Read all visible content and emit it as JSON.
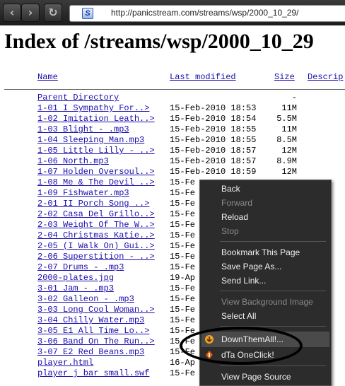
{
  "browser": {
    "url": "http://panicstream.com/streams/wsp/2000_10_29/",
    "back_icon": "back-arrow-icon",
    "forward_icon": "forward-arrow-icon",
    "reload_icon": "reload-icon",
    "favicon_letter": "S"
  },
  "page": {
    "title": "Index of /streams/wsp/2000_10_29",
    "columns": {
      "name": "Name",
      "modified": "Last modified",
      "size": "Size",
      "description": "Descrip"
    },
    "parent": {
      "name": "Parent Directory",
      "size": "-"
    },
    "rows": [
      {
        "name": "1-01 I  Sympathy For..>",
        "date": "15-Feb-2010 18:53",
        "size": "11M"
      },
      {
        "name": "1-02 Imitation Leath..>",
        "date": "15-Feb-2010 18:54",
        "size": "5.5M"
      },
      {
        "name": "1-03 Blight - .mp3",
        "date": "15-Feb-2010 18:55",
        "size": "11M"
      },
      {
        "name": "1-04 Sleeping Man.mp3",
        "date": "15-Feb-2010 18:55",
        "size": "8.5M"
      },
      {
        "name": "1-05 Little Lilly - ..>",
        "date": "15-Feb-2010 18:57",
        "size": "12M"
      },
      {
        "name": "1-06 North.mp3",
        "date": "15-Feb-2010 18:57",
        "size": "8.9M"
      },
      {
        "name": "1-07 Holden Oversoul..>",
        "date": "15-Feb-2010 18:59",
        "size": "12M"
      },
      {
        "name": "1-08 Me & The Devil ..>",
        "date": "15-Fe",
        "size": ""
      },
      {
        "name": "1-09 Fishwater.mp3",
        "date": "15-Fe",
        "size": ""
      },
      {
        "name": "2-01 II  Porch Song ..>",
        "date": "15-Fe",
        "size": ""
      },
      {
        "name": "2-02 Casa Del Grillo..>",
        "date": "15-Fe",
        "size": ""
      },
      {
        "name": "2-03 Weight Of The W..>",
        "date": "15-Fe",
        "size": ""
      },
      {
        "name": "2-04 Christmas Katie..>",
        "date": "15-Fe",
        "size": ""
      },
      {
        "name": "2-05 (I Walk On) Gui..>",
        "date": "15-Fe",
        "size": ""
      },
      {
        "name": "2-06 Superstition - ..>",
        "date": "15-Fe",
        "size": ""
      },
      {
        "name": "2-07 Drums - .mp3",
        "date": "15-Fe",
        "size": ""
      },
      {
        "name": "2000-plates.jpg",
        "date": "19-Ap",
        "size": ""
      },
      {
        "name": "3-01 Jam - .mp3",
        "date": "15-Fe",
        "size": ""
      },
      {
        "name": "3-02 Galleon - .mp3",
        "date": "15-Fe",
        "size": ""
      },
      {
        "name": "3-03 Long Cool Woman..>",
        "date": "15-Fe",
        "size": ""
      },
      {
        "name": "3-04 Chilly Water.mp3",
        "date": "15-Fe",
        "size": ""
      },
      {
        "name": "3-05 E1  All Time Lo..>",
        "date": "15-Fe",
        "size": ""
      },
      {
        "name": "3-06 Band On The Run..>",
        "date": "15-Fe",
        "size": ""
      },
      {
        "name": "3-07 E2  Red Beans.mp3",
        "date": "15-Fe",
        "size": ""
      },
      {
        "name": "player.html",
        "date": "16-Ap",
        "size": ""
      },
      {
        "name": "player j bar small.swf",
        "date": "15-Fe",
        "size": ""
      }
    ]
  },
  "context_menu": {
    "items": [
      {
        "label": "Back",
        "disabled": false
      },
      {
        "label": "Forward",
        "disabled": true
      },
      {
        "label": "Reload",
        "disabled": false
      },
      {
        "label": "Stop",
        "disabled": true
      },
      {
        "label": "Bookmark This Page",
        "disabled": false
      },
      {
        "label": "Save Page As...",
        "disabled": false
      },
      {
        "label": "Send Link...",
        "disabled": false
      },
      {
        "label": "View Background Image",
        "disabled": true
      },
      {
        "label": "Select All",
        "disabled": false
      },
      {
        "label": "DownThemAll!...",
        "disabled": false,
        "icon": "downthemall-icon",
        "highlighted": true
      },
      {
        "label": "dTa OneClick!",
        "disabled": false,
        "icon": "dta-oneclick-icon"
      },
      {
        "label": "View Page Source",
        "disabled": false
      }
    ],
    "annotation_color": "#000000"
  }
}
